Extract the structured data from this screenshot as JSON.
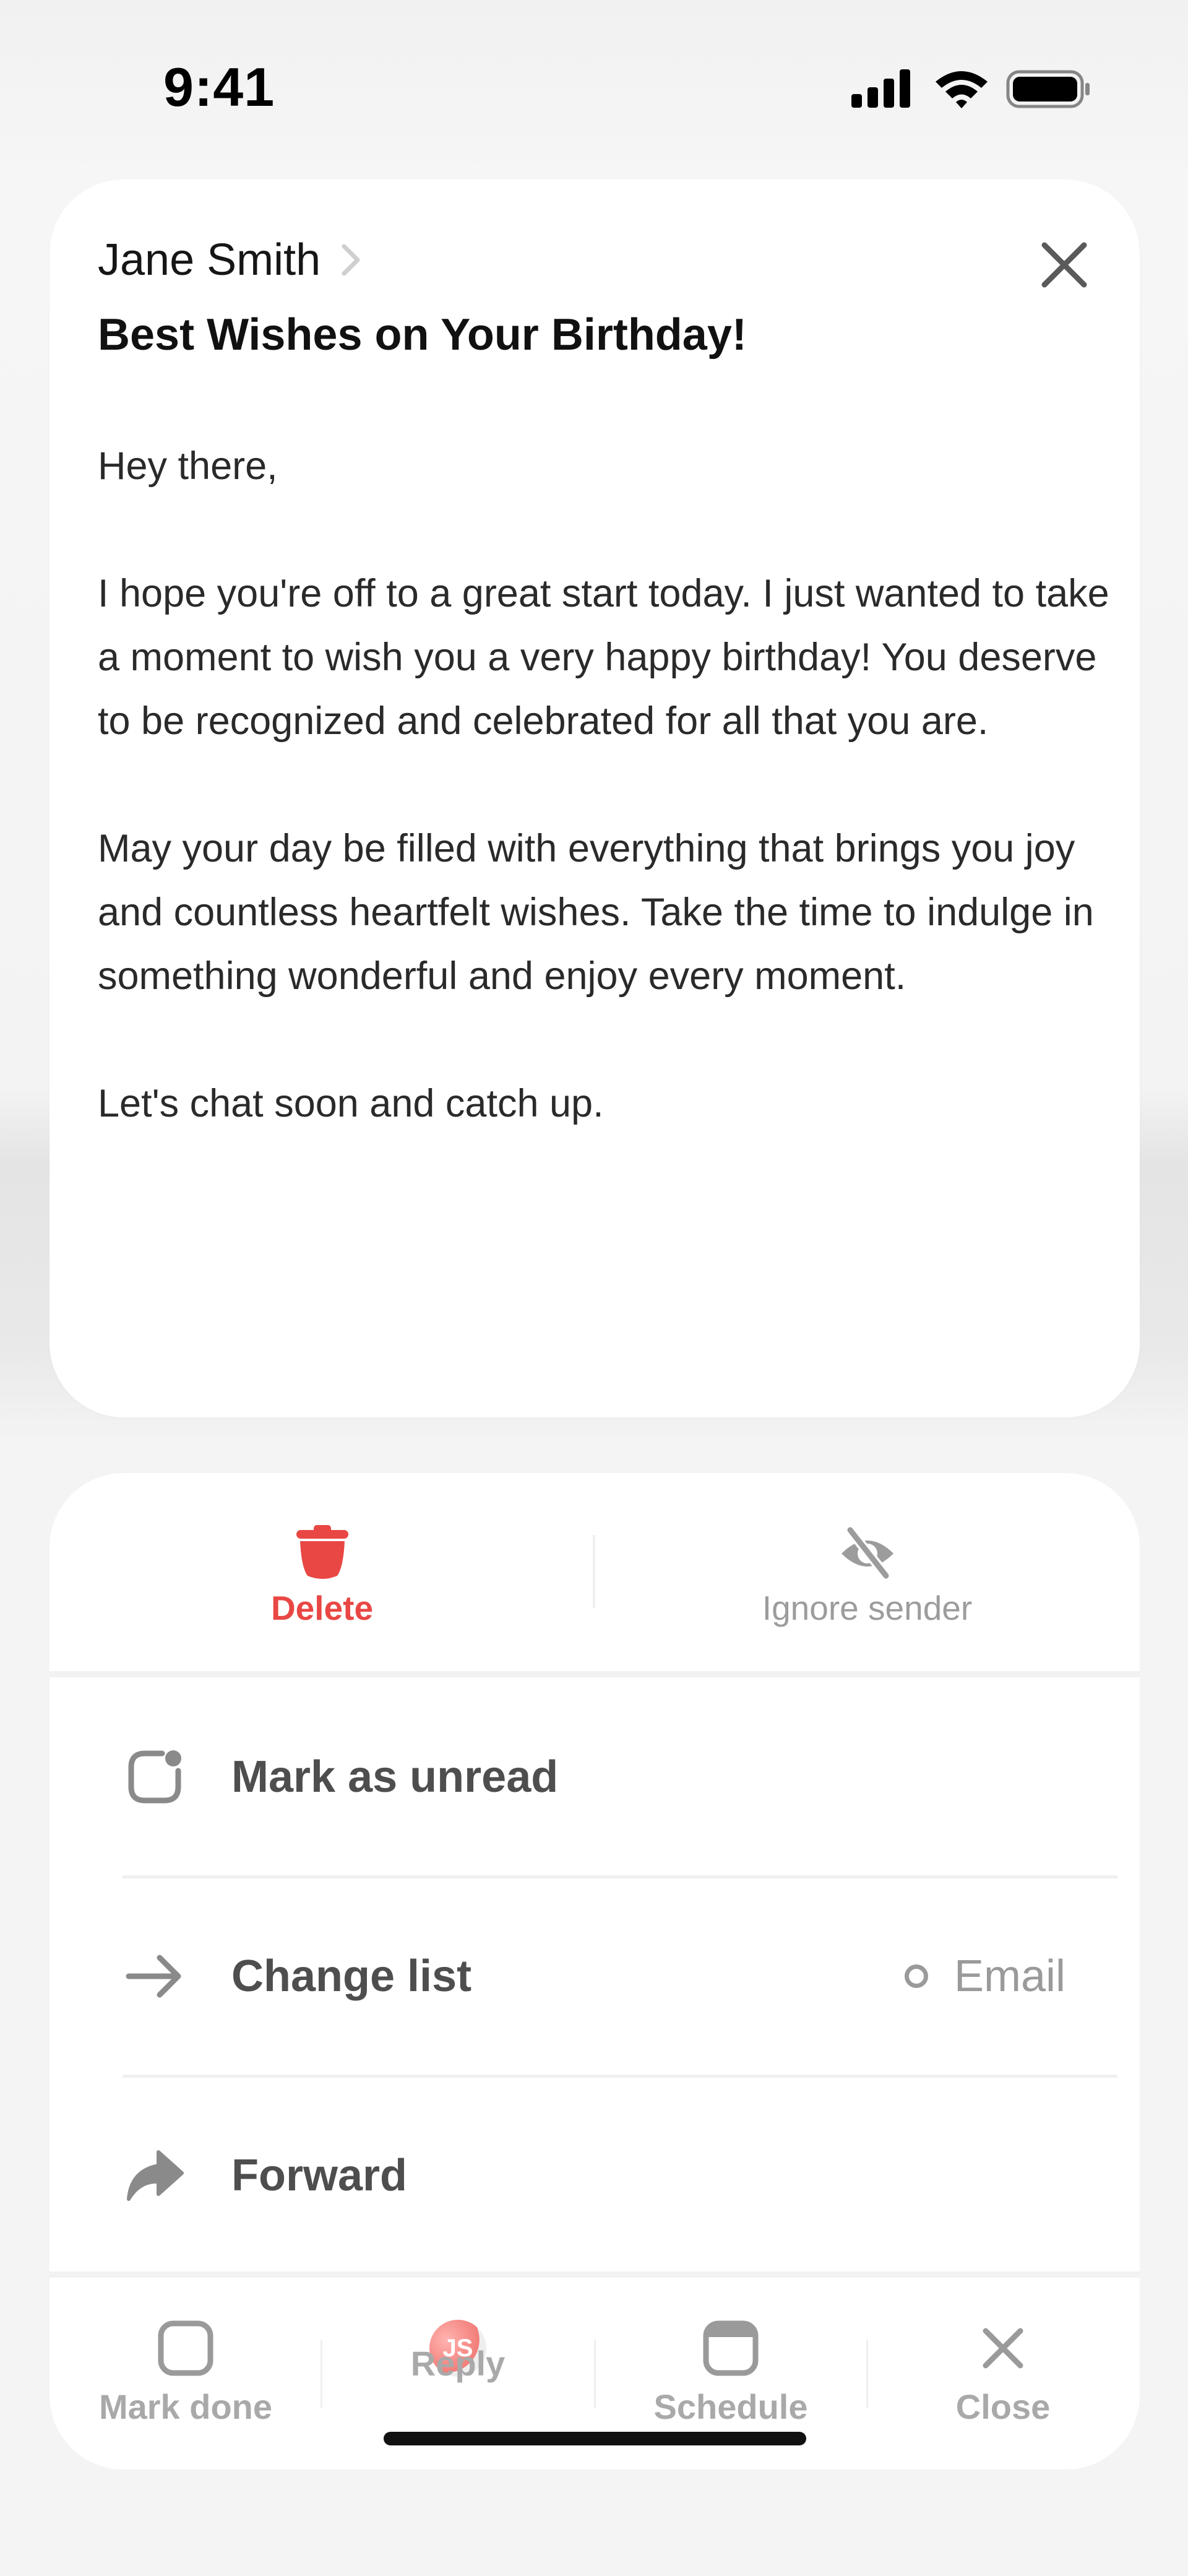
{
  "status_bar": {
    "time": "9:41"
  },
  "message": {
    "sender": "Jane Smith",
    "subject": "Best Wishes on Your Birthday!",
    "paragraphs": [
      "Hey there,",
      "I hope you're off to a great start today. I just wanted to take a moment to wish you a very happy birthday! You deserve to be recognized and celebrated for all that you are.",
      "May your day be filled with everything that brings you joy and countless heartfelt wishes. Take the time to indulge in something wonderful and enjoy every moment.",
      "Let's chat soon and catch up."
    ]
  },
  "actions": {
    "delete_label": "Delete",
    "ignore_label": "Ignore sender",
    "mark_unread_label": "Mark as unread",
    "change_list_label": "Change list",
    "change_list_value": "Email",
    "forward_label": "Forward"
  },
  "toolbar": {
    "mark_done_label": "Mark done",
    "reply_label": "Reply",
    "reply_avatar_initials": "JS",
    "schedule_label": "Schedule",
    "close_label": "Close"
  },
  "colors": {
    "danger": "#e94744",
    "muted": "#9c9c9c",
    "avatar": "#f27d78"
  },
  "icons": {
    "status": [
      "cellular-signal-icon",
      "wifi-icon",
      "battery-icon"
    ],
    "header": [
      "chevron-right-icon",
      "close-icon"
    ],
    "actions": [
      "trash-icon",
      "eye-slash-icon",
      "mark-unread-icon",
      "arrow-right-icon",
      "forward-icon"
    ],
    "toolbar": [
      "checkbox-icon",
      "avatar",
      "calendar-icon",
      "close-icon"
    ]
  }
}
